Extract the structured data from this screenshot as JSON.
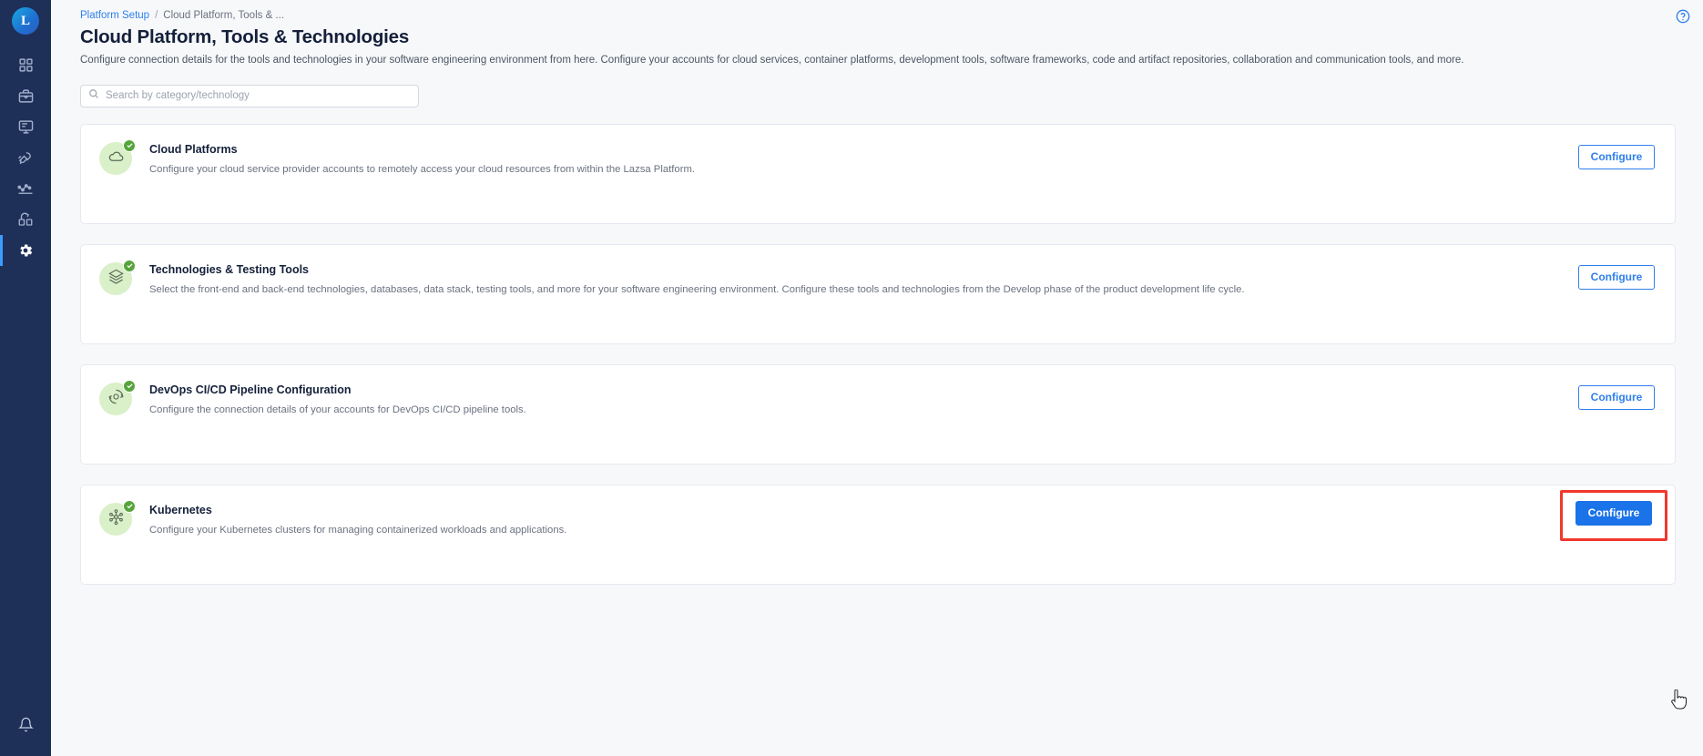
{
  "sidebar": {
    "logo_letter": "L",
    "items": [
      {
        "name": "dashboard-icon",
        "label": "Dashboard"
      },
      {
        "name": "briefcase-icon",
        "label": "Portfolio"
      },
      {
        "name": "monitor-icon",
        "label": "Workspace"
      },
      {
        "name": "rocket-icon",
        "label": "Launch"
      },
      {
        "name": "analytics-icon",
        "label": "Insights"
      },
      {
        "name": "integrations-icon",
        "label": "Integrations"
      },
      {
        "name": "gear-icon",
        "label": "Platform Setup"
      }
    ],
    "bottom_item": {
      "name": "bell-icon",
      "label": "Notifications"
    }
  },
  "header": {
    "breadcrumb": {
      "parent": "Platform Setup",
      "separator": "/",
      "current": "Cloud Platform, Tools & ..."
    },
    "title": "Cloud Platform, Tools & Technologies",
    "description": "Configure connection details for the tools and technologies in your software engineering environment from here. Configure your accounts for cloud services, container platforms, development tools, software frameworks, code and artifact repositories, collaboration and communication tools, and more.",
    "help_icon": "help-circle-icon"
  },
  "search": {
    "placeholder": "Search by category/technology",
    "value": "",
    "icon": "search-icon"
  },
  "cards": [
    {
      "id": "cloud-platforms",
      "icon": "cloud-icon",
      "status_icon": "check-circle-icon",
      "title": "Cloud Platforms",
      "description": "Configure your cloud service provider accounts to remotely access your cloud resources from within the Lazsa Platform.",
      "button_label": "Configure",
      "button_style": "outline",
      "highlighted": false
    },
    {
      "id": "technologies-testing-tools",
      "icon": "layers-icon",
      "status_icon": "check-circle-icon",
      "title": "Technologies & Testing Tools",
      "description": "Select the front-end and back-end technologies, databases, data stack, testing tools, and more for your software engineering environment. Configure these tools and technologies from the Develop phase of the product development life cycle.",
      "button_label": "Configure",
      "button_style": "outline",
      "highlighted": false
    },
    {
      "id": "devops-cicd-pipeline-configuration",
      "icon": "pipeline-icon",
      "status_icon": "check-circle-icon",
      "title": "DevOps CI/CD Pipeline Configuration",
      "description": "Configure the connection details of your accounts for DevOps CI/CD pipeline tools.",
      "button_label": "Configure",
      "button_style": "outline",
      "highlighted": false
    },
    {
      "id": "kubernetes",
      "icon": "kubernetes-icon",
      "status_icon": "check-circle-icon",
      "title": "Kubernetes",
      "description": "Configure your Kubernetes clusters for managing containerized workloads and applications.",
      "button_label": "Configure",
      "button_style": "primary",
      "highlighted": true
    }
  ],
  "colors": {
    "sidebar_bg": "#1e3058",
    "accent_blue": "#1a73e8",
    "link_blue": "#2f7fec",
    "badge_green": "#57a43c",
    "icon_bg_green": "#d9f0c8",
    "highlight_red": "#f0372c",
    "page_bg": "#f7f8fa"
  }
}
